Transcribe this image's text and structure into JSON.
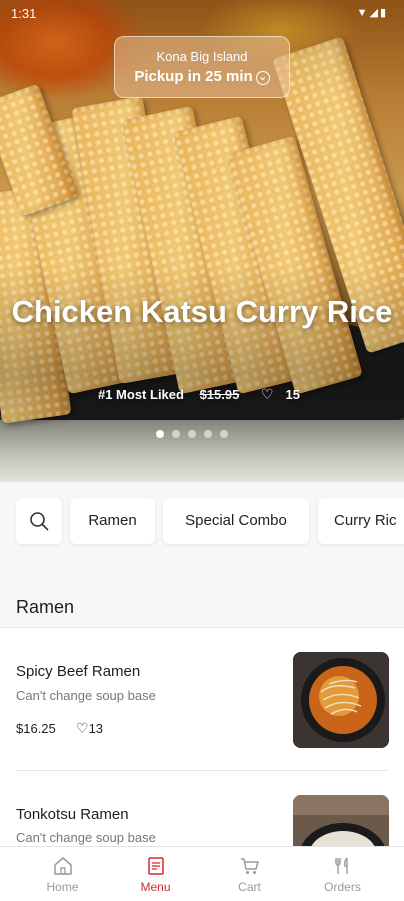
{
  "status_bar": {
    "time": "1:31",
    "icons": "▼◢▮"
  },
  "pickup": {
    "location": "Kona Big Island",
    "eta": "Pickup in 25 min"
  },
  "featured": {
    "title": "Chicken Katsu Curry Rice",
    "badge": "#1 Most Liked",
    "price": "$15.95",
    "likes": "15",
    "slide_count": 5,
    "active_slide": 1
  },
  "categories": {
    "search_icon": "search-icon",
    "items": [
      "Ramen",
      "Special Combo",
      "Curry Ric"
    ]
  },
  "section": {
    "title": "Ramen"
  },
  "menu_items": [
    {
      "name": "Spicy Beef Ramen",
      "note": "Can't change soup base",
      "price": "$16.25",
      "likes": "13"
    },
    {
      "name": "Tonkotsu Ramen",
      "note": "Can't change soup base"
    }
  ],
  "bottom_nav": {
    "active": "Menu",
    "tabs": [
      {
        "label": "Home",
        "icon": "home-icon"
      },
      {
        "label": "Menu",
        "icon": "menu-book-icon"
      },
      {
        "label": "Cart",
        "icon": "cart-icon"
      },
      {
        "label": "Orders",
        "icon": "utensils-icon"
      }
    ]
  },
  "colors": {
    "accent": "#d9282f"
  }
}
